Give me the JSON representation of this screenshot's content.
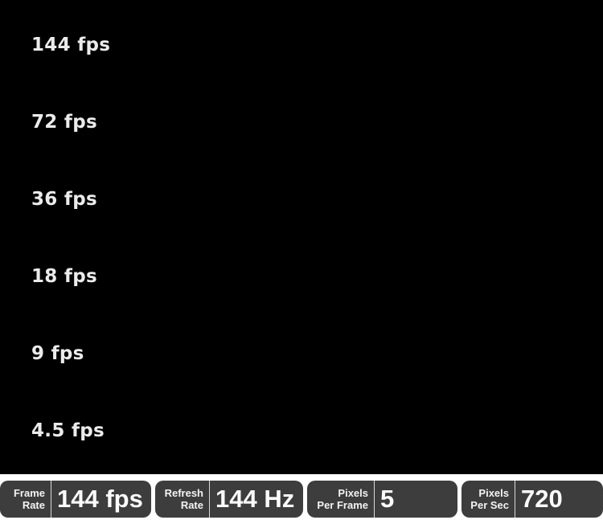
{
  "lanes": [
    {
      "label": "144 fps"
    },
    {
      "label": "72 fps"
    },
    {
      "label": "36 fps"
    },
    {
      "label": "18 fps"
    },
    {
      "label": "9 fps"
    },
    {
      "label": "4.5 fps"
    }
  ],
  "status": {
    "frame_rate": {
      "label_line1": "Frame",
      "label_line2": "Rate",
      "value": "144 fps"
    },
    "refresh_rate": {
      "label_line1": "Refresh",
      "label_line2": "Rate",
      "value": "144 Hz"
    },
    "pixels_per_frame": {
      "label_line1": "Pixels",
      "label_line2": "Per Frame",
      "value": "5"
    },
    "pixels_per_sec": {
      "label_line1": "Pixels",
      "label_line2": "Per Sec",
      "value": "720"
    }
  }
}
